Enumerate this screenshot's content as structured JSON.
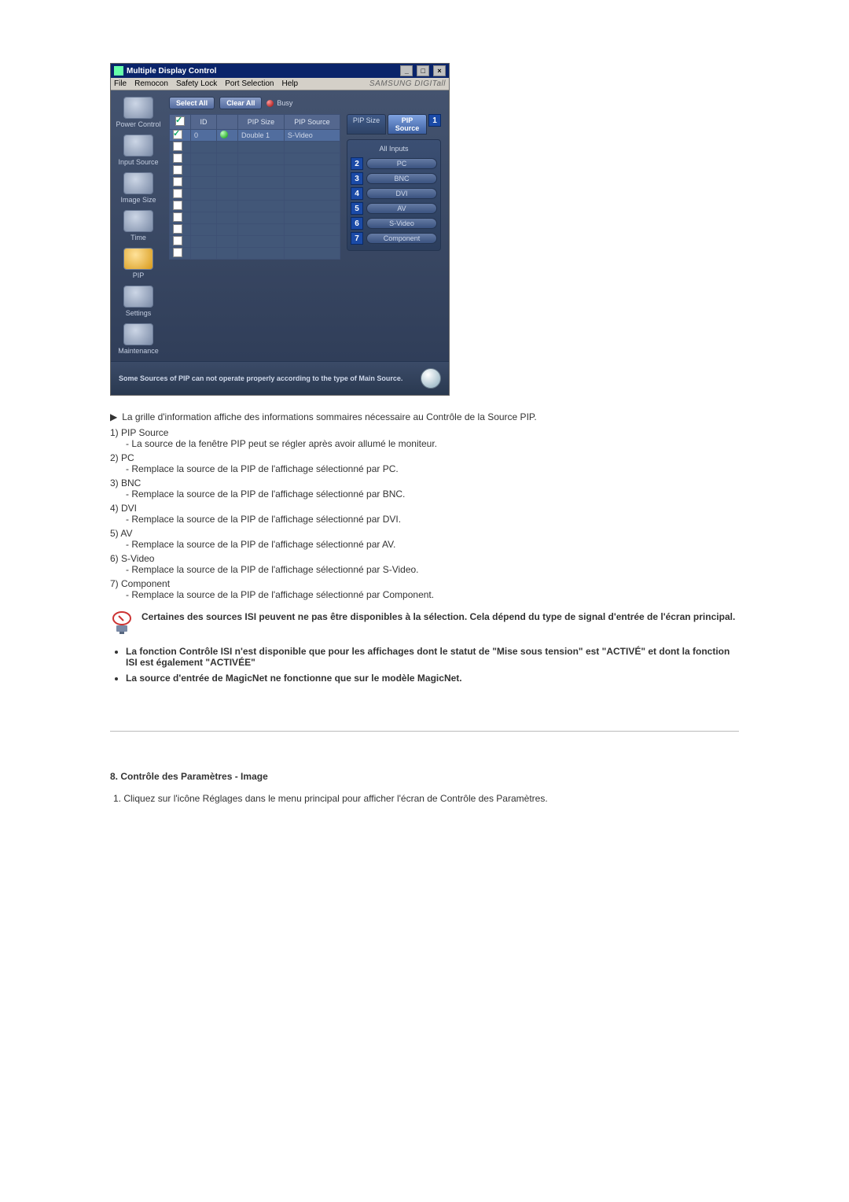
{
  "window": {
    "title": "Multiple Display Control",
    "brand": "SAMSUNG DIGITall",
    "menu": [
      "File",
      "Remocon",
      "Safety Lock",
      "Port Selection",
      "Help"
    ],
    "winbtns": {
      "min": "_",
      "max": "□",
      "close": "×"
    }
  },
  "sidebar": [
    {
      "label": "Power Control",
      "name": "power-control"
    },
    {
      "label": "Input Source",
      "name": "input-source"
    },
    {
      "label": "Image Size",
      "name": "image-size"
    },
    {
      "label": "Time",
      "name": "time"
    },
    {
      "label": "PIP",
      "name": "pip"
    },
    {
      "label": "Settings",
      "name": "settings"
    },
    {
      "label": "Maintenance",
      "name": "maintenance"
    }
  ],
  "toolbar": {
    "select_all": "Select All",
    "clear_all": "Clear All",
    "busy": "Busy"
  },
  "grid": {
    "headers": {
      "chk": "",
      "id": "ID",
      "status": "",
      "pip_size": "PIP Size",
      "pip_source": "PIP Source"
    },
    "rows": [
      {
        "checked": true,
        "id": "0",
        "pip_size": "Double 1",
        "pip_source": "S-Video",
        "status": "on"
      },
      {
        "checked": false,
        "id": "",
        "pip_size": "",
        "pip_source": "",
        "status": ""
      },
      {
        "checked": false,
        "id": "",
        "pip_size": "",
        "pip_source": "",
        "status": ""
      },
      {
        "checked": false,
        "id": "",
        "pip_size": "",
        "pip_source": "",
        "status": ""
      },
      {
        "checked": false,
        "id": "",
        "pip_size": "",
        "pip_source": "",
        "status": ""
      },
      {
        "checked": false,
        "id": "",
        "pip_size": "",
        "pip_source": "",
        "status": ""
      },
      {
        "checked": false,
        "id": "",
        "pip_size": "",
        "pip_source": "",
        "status": ""
      },
      {
        "checked": false,
        "id": "",
        "pip_size": "",
        "pip_source": "",
        "status": ""
      },
      {
        "checked": false,
        "id": "",
        "pip_size": "",
        "pip_source": "",
        "status": ""
      },
      {
        "checked": false,
        "id": "",
        "pip_size": "",
        "pip_source": "",
        "status": ""
      },
      {
        "checked": false,
        "id": "",
        "pip_size": "",
        "pip_source": "",
        "status": ""
      }
    ]
  },
  "right": {
    "tabs": {
      "size": "PIP Size",
      "source": "PIP Source",
      "badge": "1"
    },
    "all_inputs": "All Inputs",
    "inputs": [
      {
        "num": "2",
        "label": "PC"
      },
      {
        "num": "3",
        "label": "BNC"
      },
      {
        "num": "4",
        "label": "DVI"
      },
      {
        "num": "5",
        "label": "AV"
      },
      {
        "num": "6",
        "label": "S-Video"
      },
      {
        "num": "7",
        "label": "Component"
      }
    ]
  },
  "footer_note": "Some Sources of PIP can not operate properly according to the type of Main Source.",
  "doc": {
    "intro": "La grille d'information affiche des informations sommaires nécessaire au Contrôle de la Source PIP.",
    "items": [
      {
        "n": "1) ",
        "title": "PIP Source",
        "desc": "- La source de la fenêtre PIP peut se régler après avoir allumé le moniteur."
      },
      {
        "n": "2) ",
        "title": "PC",
        "desc": "- Remplace la source de la PIP de l'affichage sélectionné par PC."
      },
      {
        "n": "3) ",
        "title": "BNC",
        "desc": "- Remplace la source de la PIP de l'affichage sélectionné par BNC."
      },
      {
        "n": "4) ",
        "title": "DVI",
        "desc": "- Remplace la source de la PIP de l'affichage sélectionné par DVI."
      },
      {
        "n": "5) ",
        "title": "AV",
        "desc": "- Remplace la source de la PIP de l'affichage sélectionné par AV."
      },
      {
        "n": "6) ",
        "title": "S-Video",
        "desc": "- Remplace la source de la PIP de l'affichage sélectionné par S-Video."
      },
      {
        "n": "7) ",
        "title": "Component",
        "desc": "- Remplace la source de la PIP de l'affichage sélectionné par Component."
      }
    ],
    "note_icon_text": "Certaines des sources ISI peuvent ne pas être disponibles à la sélection. Cela dépend du type de signal d'entrée de l'écran principal.",
    "bullets": [
      "La fonction Contrôle ISI n'est disponible que pour les affichages dont le statut de \"Mise sous tension\" est \"ACTIVÉ\" et dont la fonction ISI est également \"ACTIVÉE\"",
      "La source d'entrée de MagicNet ne fonctionne que sur le modèle MagicNet."
    ],
    "section_title": "8. Contrôle des Paramètres - Image",
    "section_step": "1.  Cliquez sur l'icône Réglages dans le menu principal pour afficher l'écran de Contrôle des Paramètres."
  }
}
